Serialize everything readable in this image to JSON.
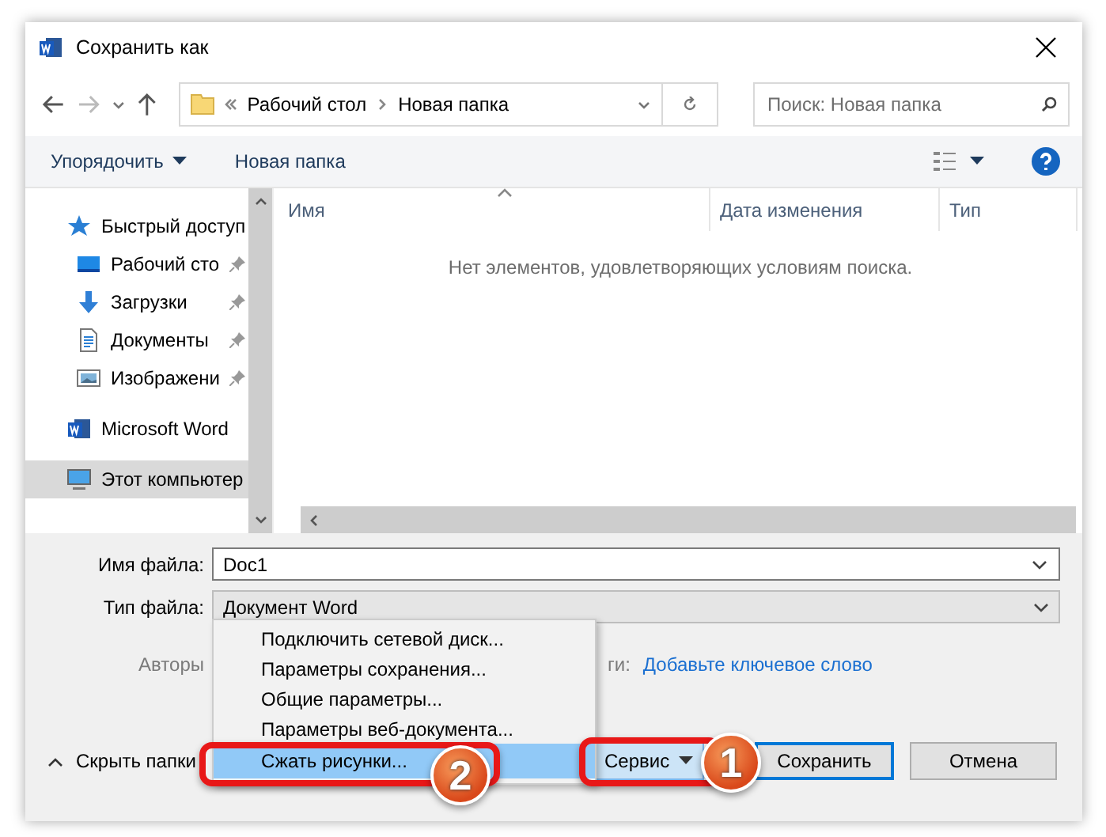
{
  "window": {
    "title": "Сохранить как"
  },
  "address": {
    "crumbs": [
      "Рабочий стол",
      "Новая папка"
    ]
  },
  "search": {
    "placeholder": "Поиск: Новая папка"
  },
  "toolbar": {
    "organize": "Упорядочить",
    "new_folder": "Новая папка"
  },
  "sidebar": {
    "items": [
      {
        "label": "Быстрый доступ",
        "kind": "star",
        "pinned": false,
        "selected": false
      },
      {
        "label": "Рабочий сто",
        "kind": "desktop",
        "pinned": true,
        "selected": false
      },
      {
        "label": "Загрузки",
        "kind": "downloads",
        "pinned": true,
        "selected": false
      },
      {
        "label": "Документы",
        "kind": "documents",
        "pinned": true,
        "selected": false
      },
      {
        "label": "Изображени",
        "kind": "pictures",
        "pinned": true,
        "selected": false
      },
      {
        "label": "Microsoft Word",
        "kind": "word",
        "pinned": false,
        "selected": false
      },
      {
        "label": "Этот компьютер",
        "kind": "computer",
        "pinned": false,
        "selected": true
      }
    ]
  },
  "table": {
    "columns": [
      "Имя",
      "Дата изменения",
      "Тип"
    ],
    "empty_message": "Нет элементов, удовлетворяющих условиям поиска."
  },
  "form": {
    "filename_label": "Имя файла:",
    "filename": "Doc1",
    "type_label": "Тип файла:",
    "type": "Документ Word",
    "authors_label": "Авторы",
    "tags_label": "ги:",
    "tags_link": "Добавьте ключевое слово"
  },
  "footer": {
    "hide_folders": "Скрыть папки",
    "tools": "Сервис",
    "save": "Сохранить",
    "cancel": "Отмена"
  },
  "menu": {
    "items": [
      {
        "label": "Подключить сетевой диск...",
        "selected": false
      },
      {
        "label": "Параметры сохранения...",
        "selected": false
      },
      {
        "label": "Общие параметры...",
        "selected": false
      },
      {
        "label": "Параметры веб-документа...",
        "selected": false
      },
      {
        "label": "Сжать рисунки...",
        "selected": true
      }
    ]
  },
  "callouts": [
    {
      "number": "2"
    },
    {
      "number": "1"
    }
  ]
}
